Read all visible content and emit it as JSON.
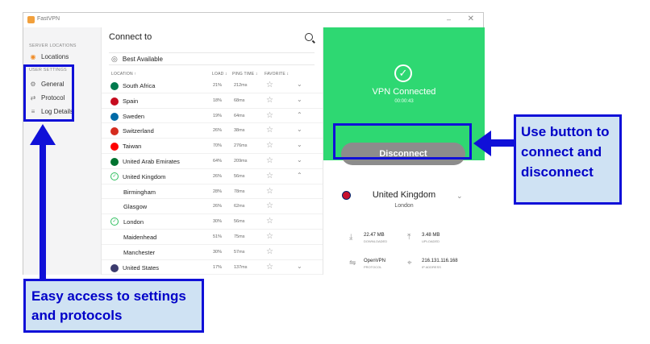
{
  "app": {
    "title": "FastVPN",
    "min_symbol": "–",
    "close_symbol": "✕"
  },
  "sidebar": {
    "server_heading": "SERVER LOCATIONS",
    "locations_label": "Locations",
    "settings_heading": "USER SETTINGS",
    "items": [
      {
        "label": "General",
        "icon": "gear-icon"
      },
      {
        "label": "Protocol",
        "icon": "swap-arrows-icon"
      },
      {
        "label": "Log Details",
        "icon": "list-icon"
      }
    ]
  },
  "list": {
    "title": "Connect to",
    "best_available": "Best Available",
    "columns": {
      "location": "LOCATION ↑",
      "load": "LOAD ↕",
      "ping": "PING TIME ↕",
      "favorite": "FAVORITE ↕"
    },
    "rows": [
      {
        "name": "South Africa",
        "load": "21%",
        "ping": "212ms",
        "chevron": "⌄",
        "flag": "#007a4d"
      },
      {
        "name": "Spain",
        "load": "18%",
        "ping": "68ms",
        "chevron": "⌄",
        "flag": "#c60b1e"
      },
      {
        "name": "Sweden",
        "load": "19%",
        "ping": "64ms",
        "chevron": "⌃",
        "flag": "#006aa7"
      },
      {
        "name": "Switzerland",
        "load": "26%",
        "ping": "38ms",
        "chevron": "⌄",
        "flag": "#d52b1e"
      },
      {
        "name": "Taiwan",
        "load": "70%",
        "ping": "276ms",
        "chevron": "⌄",
        "flag": "#fe0000"
      },
      {
        "name": "United Arab Emirates",
        "load": "64%",
        "ping": "209ms",
        "chevron": "⌄",
        "flag": "#00732f"
      },
      {
        "name": "United Kingdom",
        "load": "26%",
        "ping": "56ms",
        "chevron": "⌃",
        "connected": true
      },
      {
        "name": "Birmingham",
        "load": "28%",
        "ping": "78ms",
        "city": true
      },
      {
        "name": "Glasgow",
        "load": "26%",
        "ping": "62ms",
        "city": true
      },
      {
        "name": "London",
        "load": "30%",
        "ping": "56ms",
        "city": true,
        "connected": true
      },
      {
        "name": "Maidenhead",
        "load": "51%",
        "ping": "75ms",
        "city": true
      },
      {
        "name": "Manchester",
        "load": "30%",
        "ping": "57ms",
        "city": true
      },
      {
        "name": "United States",
        "load": "17%",
        "ping": "137ms",
        "chevron": "⌄",
        "flag": "#3c3b6e"
      }
    ]
  },
  "status": {
    "text": "VPN Connected",
    "timer": "00:00:43",
    "button_label": "Disconnect",
    "country": "United Kingdom",
    "city": "London",
    "stats": [
      {
        "value": "22.47 MB",
        "label": "DOWNLOADED",
        "icon": "download-icon"
      },
      {
        "value": "3.48 MB",
        "label": "UPLOADED",
        "icon": "upload-icon"
      },
      {
        "value": "OpenVPN",
        "label": "PROTOCOL",
        "icon": "protocol-icon"
      },
      {
        "value": "216.131.116.168",
        "label": "IP ADDRESS",
        "icon": "location-icon"
      }
    ]
  },
  "annotations": {
    "right": "Use button to connect and disconnect",
    "bottom": "Easy access to settings and protocols"
  },
  "colors": {
    "accent_green": "#2ed872",
    "annotation_blue": "#1010d8",
    "callout_bg": "#cfe2f3"
  }
}
